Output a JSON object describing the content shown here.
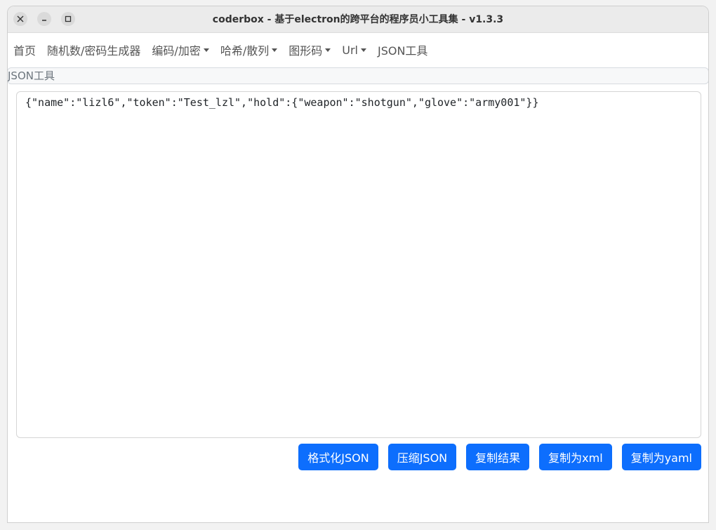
{
  "window": {
    "title": "coderbox - 基于electron的跨平台的程序员小工具集 - v1.3.3"
  },
  "nav": {
    "items": [
      {
        "label": "首页",
        "dropdown": false
      },
      {
        "label": "随机数/密码生成器",
        "dropdown": false
      },
      {
        "label": "编码/加密",
        "dropdown": true
      },
      {
        "label": "哈希/散列",
        "dropdown": true
      },
      {
        "label": "图形码",
        "dropdown": true
      },
      {
        "label": "Url",
        "dropdown": true
      },
      {
        "label": "JSON工具",
        "dropdown": false
      }
    ]
  },
  "breadcrumb": {
    "label": "JSON工具"
  },
  "editor": {
    "value": "{\"name\":\"lizl6\",\"token\":\"Test_lzl\",\"hold\":{\"weapon\":\"shotgun\",\"glove\":\"army001\"}}"
  },
  "actions": {
    "format": "格式化JSON",
    "compress": "压缩JSON",
    "copy_result": "复制结果",
    "copy_xml": "复制为xml",
    "copy_yaml": "复制为yaml"
  },
  "colors": {
    "primary": "#0d6efd",
    "titlebar": "#ebebeb"
  }
}
